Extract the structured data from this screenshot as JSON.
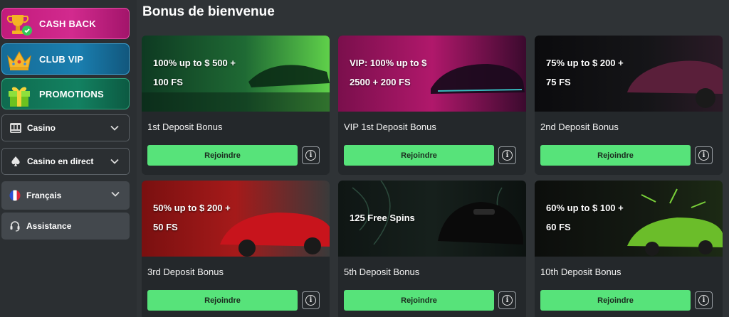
{
  "sidebar": {
    "promos": [
      {
        "label": "CASH BACK",
        "icon": "cashback-trophy-icon"
      },
      {
        "label": "CLUB VIP",
        "icon": "crown-icon"
      },
      {
        "label": "PROMOTIONS",
        "icon": "gift-icon"
      }
    ],
    "nav": [
      {
        "label": "Casino",
        "icon": "slot-machine-icon"
      },
      {
        "label": "Casino en direct",
        "icon": "spade-icon"
      },
      {
        "label": "Français",
        "icon": "france-flag-icon"
      },
      {
        "label": "Assistance",
        "icon": "headset-icon"
      }
    ]
  },
  "main": {
    "title": "Bonus de bienvenue",
    "join_label": "Rejoindre",
    "info_glyph": "i",
    "cards": [
      {
        "line1": "100% up to $ 500 +",
        "line2": "100 FS",
        "title": "1st Deposit Bonus"
      },
      {
        "line1": "VIP: 100% up to $",
        "line2": "2500 + 200 FS",
        "title": "VIP 1st Deposit Bonus"
      },
      {
        "line1": "75% up to $ 200 +",
        "line2": "75 FS",
        "title": "2nd Deposit Bonus"
      },
      {
        "line1": "50% up to $ 200 +",
        "line2": "50 FS",
        "title": "3rd Deposit Bonus"
      },
      {
        "line1": "125 Free Spins",
        "line2": "",
        "title": "5th Deposit Bonus"
      },
      {
        "line1": "60% up to $ 100 +",
        "line2": "60 FS",
        "title": "10th Deposit Bonus"
      }
    ]
  },
  "colors": {
    "background": "#2f3336",
    "card": "#24282b",
    "join_button": "#57e37a",
    "cashback": "#c21b7c",
    "vip": "#166c97",
    "promotions": "#0f6b4f"
  }
}
